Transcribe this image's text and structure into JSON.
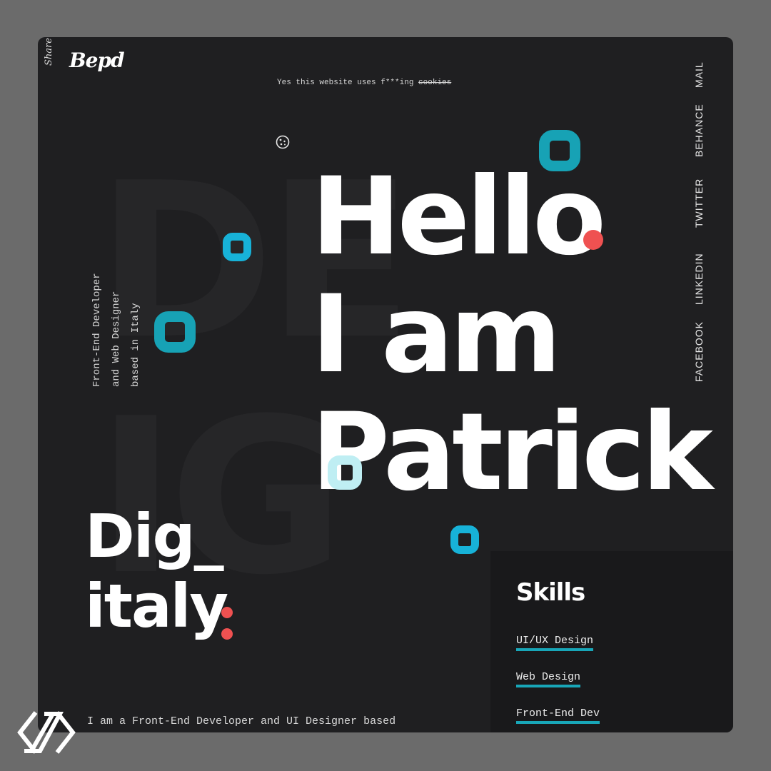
{
  "header": {
    "share_label": "Share",
    "logo_text": "Bepd",
    "cookie_prefix": "Yes this website uses f***ing",
    "cookie_strike": "cookies"
  },
  "background": {
    "lines": [
      "DE",
      "IG"
    ]
  },
  "hero": {
    "line1": "Hello",
    "line2": "I am",
    "line3": "Patrick"
  },
  "tagline": {
    "line1": "Front-End Developer",
    "line2": "and Web Designer",
    "line3": "based in Italy"
  },
  "social": [
    "MAIL",
    "BEHANCE",
    "TWITTER",
    "LINKEDIN",
    "FACEBOOK"
  ],
  "brand": {
    "line1": "Dig_",
    "line2": "italy"
  },
  "intro": "I am a Front-End Developer and UI Designer based",
  "skills": {
    "title": "Skills",
    "items": [
      "UI/UX Design",
      "Web Design",
      "Front-End Dev"
    ]
  },
  "colors": {
    "background": "#1f1f21",
    "accent_teal": "#18a6b8",
    "accent_red": "#ef5151",
    "text": "#ffffff"
  },
  "icons": [
    "cookie-icon",
    "watermark-logo-icon"
  ]
}
